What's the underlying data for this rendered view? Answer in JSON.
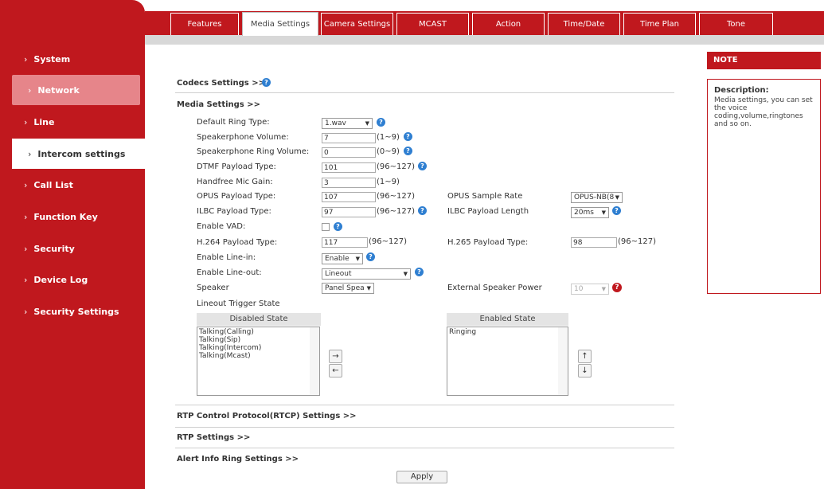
{
  "sidebar": {
    "items": [
      {
        "label": "System"
      },
      {
        "label": "Network"
      },
      {
        "label": "Line"
      },
      {
        "label": "Intercom settings"
      },
      {
        "label": "Call List"
      },
      {
        "label": "Function Key"
      },
      {
        "label": "Security"
      },
      {
        "label": "Device Log"
      },
      {
        "label": "Security Settings"
      }
    ]
  },
  "tabs": [
    {
      "label": "Features"
    },
    {
      "label": "Media Settings"
    },
    {
      "label": "Camera Settings"
    },
    {
      "label": "MCAST"
    },
    {
      "label": "Action"
    },
    {
      "label": "Time/Date"
    },
    {
      "label": "Time Plan"
    },
    {
      "label": "Tone"
    }
  ],
  "sections": {
    "codecs": "Codecs Settings >>",
    "media": "Media Settings >>",
    "rtcp": "RTP Control Protocol(RTCP) Settings >>",
    "rtp": "RTP Settings >>",
    "alert": "Alert Info Ring Settings >>"
  },
  "form": {
    "default_ring_type": {
      "label": "Default Ring Type:",
      "value": "1.wav"
    },
    "speakerphone_volume": {
      "label": "Speakerphone Volume:",
      "value": "7",
      "range": "(1~9)"
    },
    "speakerphone_ring_volume": {
      "label": "Speakerphone Ring Volume:",
      "value": "0",
      "range": "(0~9)"
    },
    "dtmf_payload": {
      "label": "DTMF Payload Type:",
      "value": "101",
      "range": "(96~127)"
    },
    "handfree_mic_gain": {
      "label": "Handfree Mic Gain:",
      "value": "3",
      "range": "(1~9)"
    },
    "opus_payload": {
      "label": "OPUS Payload Type:",
      "value": "107",
      "range": "(96~127)"
    },
    "opus_sample_rate": {
      "label": "OPUS Sample Rate",
      "value": "OPUS-NB(8"
    },
    "ilbc_payload": {
      "label": "ILBC Payload Type:",
      "value": "97",
      "range": "(96~127)"
    },
    "ilbc_payload_length": {
      "label": "ILBC Payload Length",
      "value": "20ms"
    },
    "enable_vad": {
      "label": "Enable VAD:"
    },
    "h264_payload": {
      "label": "H.264 Payload Type:",
      "value": "117",
      "range": "(96~127)"
    },
    "h265_payload": {
      "label": "H.265 Payload Type:",
      "value": "98",
      "range": "(96~127)"
    },
    "enable_line_in": {
      "label": "Enable Line-in:",
      "value": "Enable"
    },
    "enable_line_out": {
      "label": "Enable Line-out:",
      "value": "Lineout"
    },
    "speaker": {
      "label": "Speaker",
      "value": "Panel Spea"
    },
    "external_speaker_power": {
      "label": "External Speaker Power",
      "value": "10"
    },
    "lineout_trigger_state": {
      "label": "Lineout Trigger State"
    }
  },
  "lists": {
    "disabled_header": "Disabled State",
    "disabled_items": [
      "Talking(Calling)",
      "Talking(Sip)",
      "Talking(Intercom)",
      "Talking(Mcast)"
    ],
    "enabled_header": "Enabled State",
    "enabled_items": [
      "Ringing"
    ],
    "move_right": "→",
    "move_left": "←",
    "move_up": "↑",
    "move_down": "↓"
  },
  "apply_label": "Apply",
  "note": {
    "header": "NOTE",
    "desc_title": "Description:",
    "desc_text": "Media settings, you can set the voice coding,volume,ringtones and so on."
  },
  "icons": {
    "help": "?",
    "warn": "?",
    "chevron": "›",
    "arrow_down": "▼"
  },
  "colors": {
    "brand_red": "#c0181e",
    "help_blue": "#2f7fd1"
  }
}
